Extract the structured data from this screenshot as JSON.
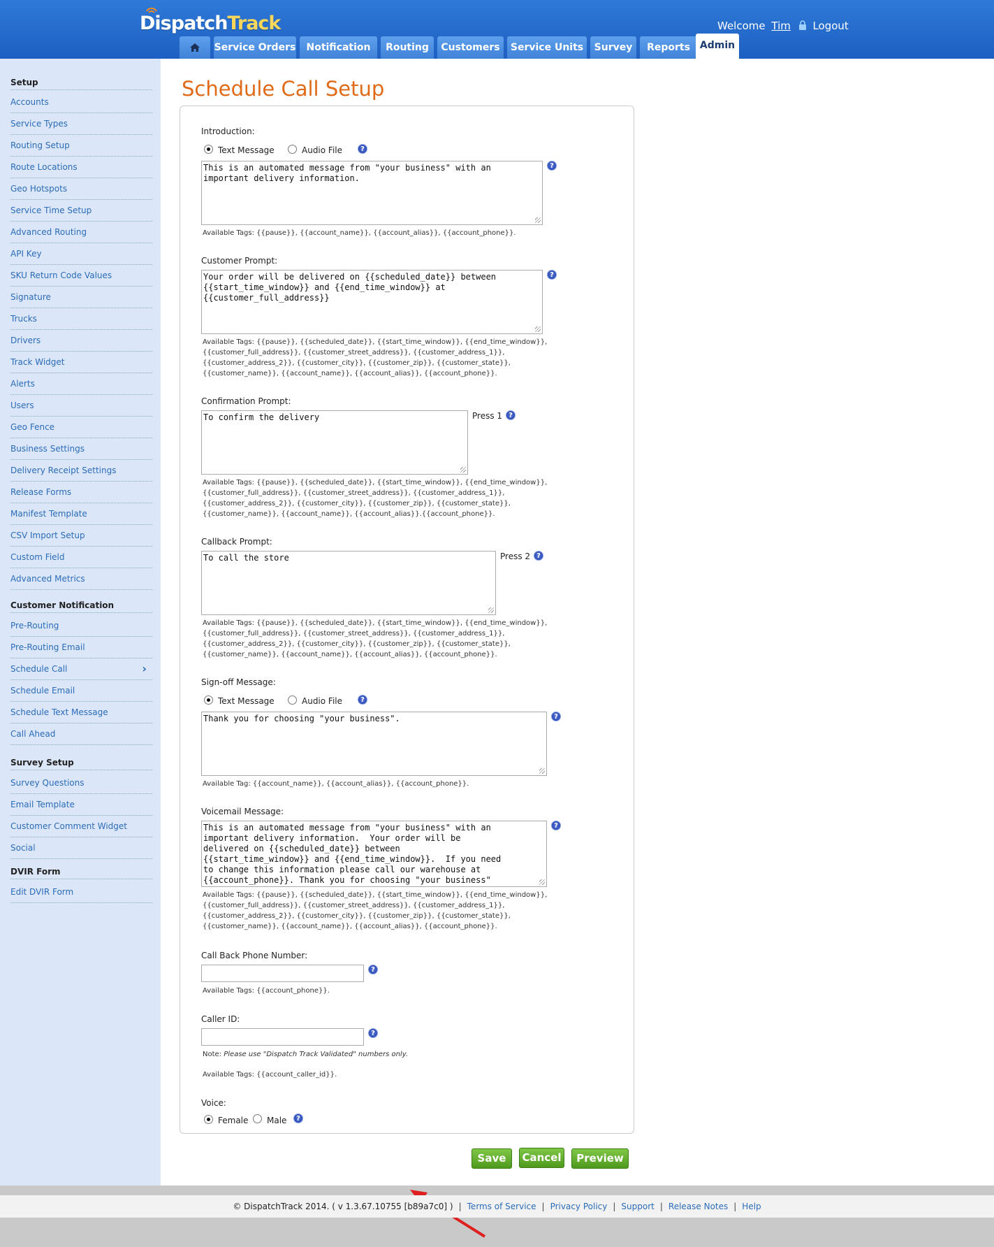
{
  "header": {
    "logo_dispatch": "Dispatch",
    "logo_track": "Track",
    "welcome": "Welcome",
    "user": "Tim",
    "logout": "Logout",
    "tabs": [
      "Service Orders",
      "Notification",
      "Routing",
      "Customers",
      "Service Units",
      "Survey",
      "Reports",
      "Admin"
    ],
    "active_tab": "Admin"
  },
  "sidebar": {
    "setup_heading": "Setup",
    "setup_items": [
      "Accounts",
      "Service Types",
      "Routing Setup",
      "Route Locations",
      "Geo Hotspots",
      "Service Time Setup",
      "Advanced Routing",
      "API Key",
      "SKU Return Code Values",
      "Signature",
      "Trucks",
      "Drivers",
      "Track Widget",
      "Alerts",
      "Users",
      "Geo Fence",
      "Business Settings",
      "Delivery Receipt Settings",
      "Release Forms",
      "Manifest Template",
      "CSV Import Setup",
      "Custom Field",
      "Advanced Metrics"
    ],
    "notification_heading": "Customer Notification",
    "notification_items": [
      "Pre-Routing",
      "Pre-Routing Email",
      "Schedule Call",
      "Schedule Email",
      "Schedule Text Message",
      "Call Ahead"
    ],
    "survey_heading": "Survey Setup",
    "survey_items": [
      "Survey Questions",
      "Email Template",
      "Customer Comment Widget",
      "Social"
    ],
    "dvir_heading": "DVIR Form",
    "dvir_items": [
      "Edit DVIR Form"
    ]
  },
  "main": {
    "title": "Schedule Call Setup",
    "introduction": {
      "label": "Introduction:",
      "opt_text": "Text Message",
      "opt_audio": "Audio File",
      "value": "This is an automated message from \"your business\" with an\nimportant delivery information.",
      "tags": "Available Tags: {{pause}}, {{account_name}}, {{account_alias}}, {{account_phone}}."
    },
    "customer_prompt": {
      "label": "Customer Prompt:",
      "value": "Your order will be delivered on {{scheduled_date}} between\n{{start_time_window}} and {{end_time_window}} at\n{{customer_full_address}}",
      "tags1": "Available Tags: {{pause}}, {{scheduled_date}}, {{start_time_window}}, {{end_time_window}},",
      "tags2": "{{customer_full_address}}, {{customer_street_address}}, {{customer_address_1}},",
      "tags3": "{{customer_address_2}}, {{customer_city}}, {{customer_zip}}, {{customer_state}},",
      "tags4": "{{customer_name}}, {{account_name}}, {{account_alias}}, {{account_phone}}."
    },
    "confirmation_prompt": {
      "label": "Confirmation Prompt:",
      "value": "To confirm the delivery",
      "press": "Press 1",
      "tags1": "Available Tags: {{pause}}, {{scheduled_date}}, {{start_time_window}}, {{end_time_window}},",
      "tags2": "{{customer_full_address}}, {{customer_street_address}}, {{customer_address_1}},",
      "tags3": "{{customer_address_2}}, {{customer_city}}, {{customer_zip}}, {{customer_state}},",
      "tags4": "{{customer_name}}, {{account_name}}, {{account_alias}}.{{account_phone}}."
    },
    "callback_prompt": {
      "label": "Callback Prompt:",
      "value": "To call the store",
      "press": "Press 2",
      "tags1": "Available Tags: {{pause}}, {{scheduled_date}}, {{start_time_window}}, {{end_time_window}},",
      "tags2": "{{customer_full_address}}, {{customer_street_address}}, {{customer_address_1}},",
      "tags3": "{{customer_address_2}}, {{customer_city}}, {{customer_zip}}, {{customer_state}},",
      "tags4": "{{customer_name}}, {{account_name}}, {{account_alias}}, {{account_phone}}."
    },
    "signoff": {
      "label": "Sign-off Message:",
      "opt_text": "Text Message",
      "opt_audio": "Audio File",
      "value": "Thank you for choosing \"your business\".",
      "tags": "Available Tag: {{account_name}}, {{account_alias}}, {{account_phone}}."
    },
    "voicemail": {
      "label": "Voicemail Message:",
      "value": "This is an automated message from \"your business\" with an\nimportant delivery information.  Your order will be\ndelivered on {{scheduled_date}} between\n{{start_time_window}} and {{end_time_window}}.  If you need\nto change this information please call our warehouse at\n{{account_phone}}. Thank you for choosing \"your business\"",
      "tags1": "Available Tags: {{pause}}, {{scheduled_date}}, {{start_time_window}}, {{end_time_window}},",
      "tags2": "{{customer_full_address}}, {{customer_street_address}}, {{customer_address_1}},",
      "tags3": "{{customer_address_2}}, {{customer_city}}, {{customer_zip}}, {{customer_state}},",
      "tags4": "{{customer_name}}, {{account_name}}, {{account_alias}}, {{account_phone}}."
    },
    "callback_phone": {
      "label": "Call Back Phone Number:",
      "value": "",
      "tags": "Available Tags: {{account_phone}}."
    },
    "caller_id": {
      "label": "Caller ID:",
      "value": "",
      "note_prefix": "Note: ",
      "note": "Please use \"Dispatch Track Validated\" numbers only.",
      "tags": "Available Tags: {{account_caller_id}}."
    },
    "voice": {
      "label": "Voice:",
      "female": "Female",
      "male": "Male",
      "selected": "Female"
    },
    "buttons": {
      "save": "Save",
      "cancel": "Cancel",
      "preview": "Preview"
    }
  },
  "footer": {
    "copyright": "© DispatchTrack 2014. ( v 1.3.67.10755 [b89a7c0] )",
    "links": [
      "Terms of Service",
      "Privacy Policy",
      "Support",
      "Release Notes",
      "Help"
    ]
  },
  "colors": {
    "accent": "#e06a17",
    "header": "#2f7ad8",
    "link": "#2b6cb8",
    "button": "#5aa626"
  }
}
